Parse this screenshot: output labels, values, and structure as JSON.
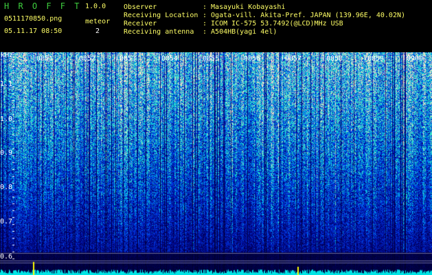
{
  "app": {
    "name": "H R O F F T",
    "version": "1.0.0"
  },
  "file": {
    "name": "0511170850.png",
    "datetime": "05.11.17 08:50"
  },
  "meteor": {
    "label": "meteor",
    "count": "2"
  },
  "info": [
    {
      "key": "Observer",
      "value": ": Masayuki Kobayashi"
    },
    {
      "key": "Receiving Location",
      "value": ": Ogata-vill. Akita-Pref. JAPAN (139.96E, 40.02N)"
    },
    {
      "key": "Receiver",
      "value": ": ICOM IC-575 53.7492(@LCD)MHz USB"
    },
    {
      "key": "Receiving antenna",
      "value": ": A504HB(yagi 4el)"
    }
  ],
  "axis": {
    "unit": "kHz",
    "freq_ticks": [
      "1.1",
      "1.0",
      "0.9",
      "0.8",
      "0.7",
      "0.6"
    ],
    "time_ticks": [
      "0851",
      "0852",
      "0853",
      "0854",
      "0855",
      "0856",
      "0857",
      "0858",
      "0859",
      "0900"
    ]
  },
  "colors": {
    "accent": "#ffff66",
    "logo": "#3ecf3e",
    "spectrum_high": "#00e5e5",
    "spectrum_low": "#000044"
  }
}
